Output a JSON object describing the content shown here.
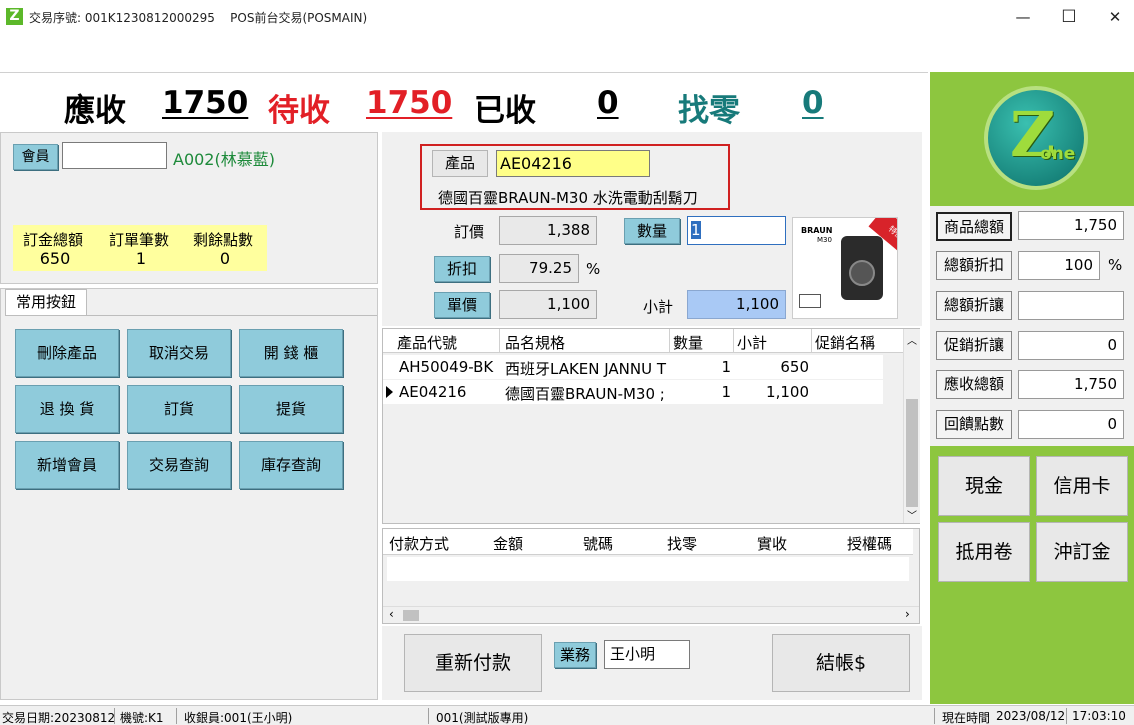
{
  "window": {
    "title": "交易序號: 001K1230812000295    POS前台交易(POSMAIN)",
    "logo_letter": "Z",
    "minimize": "—",
    "maximize": "☐",
    "close": "✕"
  },
  "summary": {
    "receivable_label": "應收",
    "receivable_value": "1750",
    "pending_label": "待收",
    "pending_value": "1750",
    "received_label": "已收",
    "received_value": "0",
    "change_label": "找零",
    "change_value": "0"
  },
  "member": {
    "button": "會員",
    "input_value": "",
    "name": "A002(林慕藍)"
  },
  "order_stats": [
    {
      "label": "訂金總額",
      "value": "650"
    },
    {
      "label": "訂單筆數",
      "value": "1"
    },
    {
      "label": "剩餘點數",
      "value": "0"
    }
  ],
  "common_tab": "常用按鈕",
  "common_buttons": [
    "刪除產品",
    "取消交易",
    "開 錢 櫃",
    "退 換 貨",
    "訂貨",
    "提貨",
    "新增會員",
    "交易查詢",
    "庫存查詢"
  ],
  "product": {
    "button": "產品",
    "code": "AE04216",
    "name": "德國百靈BRAUN-M30 水洗電動刮鬍刀",
    "list_price_label": "訂價",
    "list_price": "1,388",
    "qty_button": "數量",
    "qty": "1",
    "discount_button": "折扣",
    "discount": "79.25",
    "percent": "%",
    "unit_price_button": "單價",
    "unit_price": "1,100",
    "subtotal_label": "小計",
    "subtotal": "1,100",
    "image_brand": "BRAUN",
    "image_model": "M30",
    "image_badge": "特價"
  },
  "items_grid": {
    "columns": [
      "產品代號",
      "品名規格",
      "數量",
      "小計",
      "促銷名稱"
    ],
    "rows": [
      {
        "code": "AH50049-BK",
        "name": "西班牙LAKEN JANNU T",
        "qty": "1",
        "subtotal": "650",
        "promo": "",
        "current": false
      },
      {
        "code": "AE04216",
        "name": "德國百靈BRAUN-M30 ;",
        "qty": "1",
        "subtotal": "1,100",
        "promo": "",
        "current": true
      }
    ]
  },
  "payment_grid": {
    "columns": [
      "付款方式",
      "金額",
      "號碼",
      "找零",
      "實收",
      "授權碼"
    ]
  },
  "bottom": {
    "repay_button": "重新付款",
    "sales_button": "業務",
    "sales_value": "王小明",
    "checkout_button": "結帳$"
  },
  "totals": [
    {
      "label": "商品總額",
      "value": "1,750",
      "selected": true
    },
    {
      "label": "總額折扣",
      "value": "100",
      "suffix": "%"
    },
    {
      "label": "總額折讓",
      "value": ""
    },
    {
      "label": "促銷折讓",
      "value": "0"
    },
    {
      "label": "應收總額",
      "value": "1,750"
    },
    {
      "label": "回饋點數",
      "value": "0"
    }
  ],
  "pay_buttons": [
    "現金",
    "信用卡",
    "抵用卷",
    "沖訂金"
  ],
  "brand_logo": {
    "letter": "Z",
    "word": "one"
  },
  "status": {
    "trade_date": "交易日期:20230812",
    "machine": "機號:K1",
    "cashier": "收銀員:001(王小明)",
    "edition": "001(測試版專用)",
    "now_label": "現在時間",
    "date": "2023/08/12",
    "time": "17:03:10"
  },
  "colors": {
    "receivable": "#000000",
    "pending": "#e21f26",
    "change": "#177a7a",
    "member_name": "#1d8a3a",
    "stats_bg": "#ffff9e",
    "product_code_bg": "#ffff88",
    "subtotal_bg": "#a9c9f5",
    "right_panel": "#8dc63f",
    "blue_button": "#8fcbdb"
  }
}
